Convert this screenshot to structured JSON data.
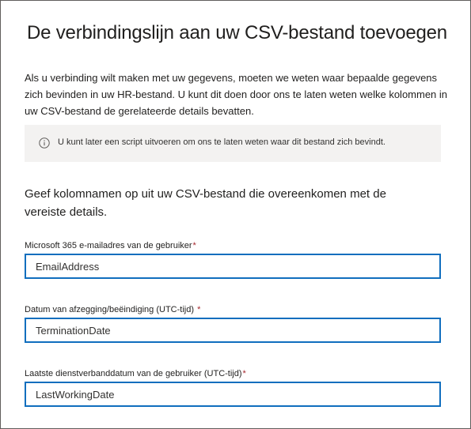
{
  "dialog": {
    "title": "De verbindingslijn aan uw CSV-bestand toevoegen",
    "description": "Als u verbinding wilt maken met uw gegevens, moeten we weten waar bepaalde gegevens zich bevinden in uw HR-bestand. U kunt dit doen door ons te laten weten welke kolommen in uw CSV-bestand de gerelateerde details bevatten.",
    "info": {
      "icon": "info-icon",
      "text": "U kunt later een script uitvoeren om ons te laten weten waar dit bestand zich bevindt."
    },
    "subheading": "Geef kolomnamen op uit uw CSV-bestand die overeenkomen met de vereiste details."
  },
  "fields": {
    "email": {
      "label": "Microsoft 365 e-mailadres van de gebruiker",
      "required_marker": "*",
      "value": "EmailAddress"
    },
    "termination": {
      "label": "Datum van afzegging/beëindiging (UTC-tijd)",
      "required_marker": "*",
      "value": "TerminationDate"
    },
    "last_working": {
      "label": "Laatste dienstverbanddatum van de gebruiker (UTC-tijd)",
      "required_marker": "*",
      "value": "LastWorkingDate"
    }
  },
  "colors": {
    "input_border": "#106ebe",
    "required": "#a4262c",
    "info_background": "#f3f2f1",
    "frame_border": "#605e5c"
  }
}
